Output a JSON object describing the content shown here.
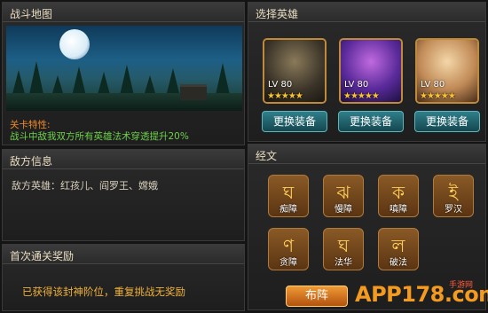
{
  "map": {
    "title": "战斗地图",
    "feature_label": "关卡特性:",
    "feature_text": "战斗中敌我双方所有英雄法术穿透提升20%"
  },
  "enemy": {
    "title": "敌方信息",
    "text": "敌方英雄：红孩儿、阎罗王、嫦娥"
  },
  "reward": {
    "title": "首次通关奖励",
    "text": "已获得该封神阶位，重复挑战无奖励"
  },
  "heroes": {
    "title": "选择英雄",
    "items": [
      {
        "level": "LV 80",
        "stars": "★★★★★",
        "button": "更换装备"
      },
      {
        "level": "LV 80",
        "stars": "★★★★★",
        "button": "更换装备"
      },
      {
        "level": "LV 80",
        "stars": "★★★★★",
        "button": "更换装备"
      }
    ]
  },
  "runes": {
    "title": "经文",
    "items": [
      {
        "glyph": "ঘ",
        "label": "痴障"
      },
      {
        "glyph": "ঝ",
        "label": "慢障"
      },
      {
        "glyph": "ক",
        "label": "嗔障"
      },
      {
        "glyph": "ই",
        "label": "罗汉"
      },
      {
        "glyph": "ণ",
        "label": "贪障"
      },
      {
        "glyph": "ঘ",
        "label": "法华"
      },
      {
        "glyph": "ল",
        "label": "破法"
      }
    ]
  },
  "formation_button": "布阵",
  "watermark": {
    "text": "APP178.com",
    "sub": "手游网"
  },
  "colors": {
    "accent_orange": "#f08a2a",
    "feature_green": "#6dd24a",
    "reward_gold": "#f0b23a",
    "equip_teal": "#2f7f8a"
  }
}
